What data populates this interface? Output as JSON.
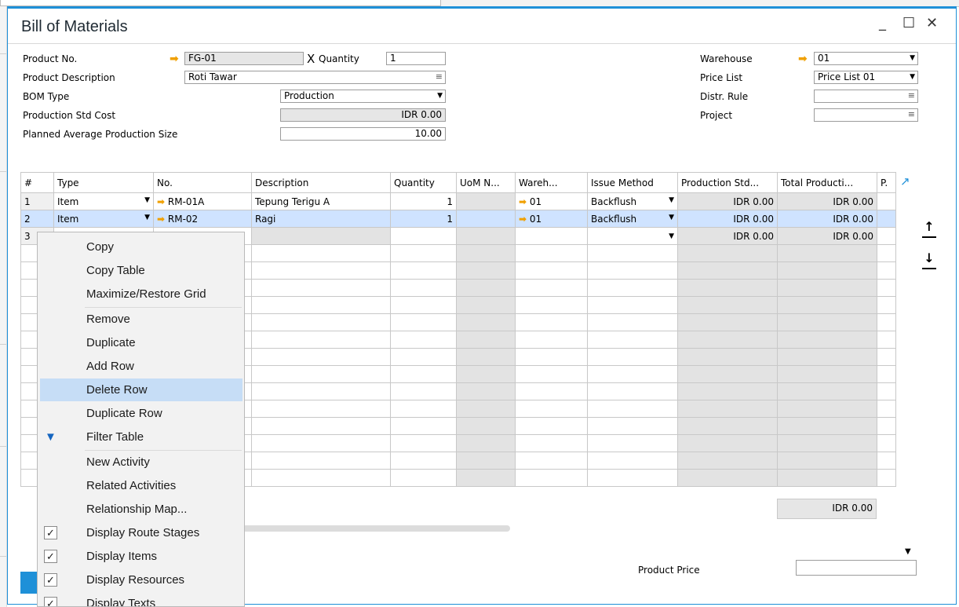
{
  "window": {
    "title": "Bill of Materials",
    "min": "_",
    "max": "☐",
    "close": "✕"
  },
  "header": {
    "product_no_label": "Product No.",
    "product_no": "FG-01",
    "x_mark": "X",
    "quantity_label": "Quantity",
    "quantity": "1",
    "product_desc_label": "Product Description",
    "product_desc": "Roti Tawar",
    "bom_type_label": "BOM Type",
    "bom_type": "Production",
    "std_cost_label": "Production Std Cost",
    "std_cost": "IDR 0.00",
    "planned_label": "Planned Average Production Size",
    "planned": "10.00",
    "warehouse_label": "Warehouse",
    "warehouse": "01",
    "price_list_label": "Price List",
    "price_list": "Price List 01",
    "distr_rule_label": "Distr. Rule",
    "distr_rule": "",
    "project_label": "Project",
    "project": ""
  },
  "grid": {
    "columns": [
      "#",
      "Type",
      "No.",
      "Description",
      "Quantity",
      "UoM N...",
      "Wareh...",
      "Issue Method",
      "Production Std...",
      "Total Producti...",
      "P."
    ],
    "rows": [
      {
        "n": "1",
        "type": "Item",
        "no": "RM-01A",
        "desc": "Tepung Terigu A",
        "qty": "1",
        "uom": "",
        "wh": "01",
        "issue": "Backflush",
        "std": "IDR 0.00",
        "total": "IDR 0.00"
      },
      {
        "n": "2",
        "type": "Item",
        "no": "RM-02",
        "desc": "Ragi",
        "qty": "1",
        "uom": "",
        "wh": "01",
        "issue": "Backflush",
        "std": "IDR 0.00",
        "total": "IDR 0.00"
      },
      {
        "n": "3",
        "type": "",
        "no": "",
        "desc": "",
        "qty": "",
        "uom": "",
        "wh": "",
        "issue": "",
        "std": "IDR 0.00",
        "total": "IDR 0.00"
      }
    ],
    "total_footer": "IDR 0.00"
  },
  "footer": {
    "product_price_label": "Product Price",
    "product_price": ""
  },
  "context_menu": {
    "items": [
      {
        "label": "Copy"
      },
      {
        "label": "Copy Table"
      },
      {
        "label": "Maximize/Restore Grid"
      },
      {
        "label": "Remove"
      },
      {
        "label": "Duplicate"
      },
      {
        "label": "Add Row"
      },
      {
        "label": "Delete Row"
      },
      {
        "label": "Duplicate Row"
      },
      {
        "label": "Filter Table"
      },
      {
        "label": "New Activity"
      },
      {
        "label": "Related Activities"
      },
      {
        "label": "Relationship Map..."
      },
      {
        "label": "Display Route Stages",
        "checked": true
      },
      {
        "label": "Display Items",
        "checked": true
      },
      {
        "label": "Display Resources",
        "checked": true
      },
      {
        "label": "Display Texts",
        "checked": true
      }
    ],
    "highlighted": "Delete Row"
  },
  "colors": {
    "accent": "#1e90d8",
    "highlight": "#c6ddf6",
    "selected_row": "#cfe3ff",
    "link_arrow": "#f0a000"
  }
}
